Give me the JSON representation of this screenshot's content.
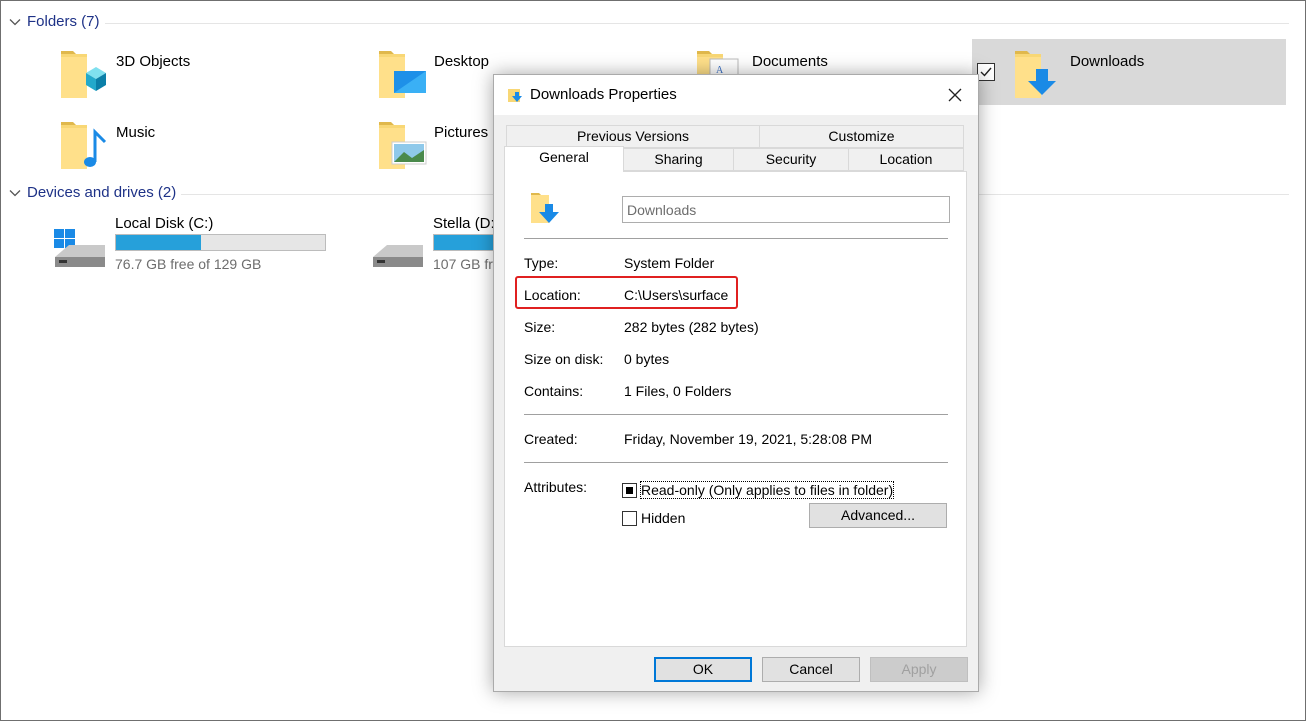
{
  "explorer": {
    "folders_group": {
      "title": "Folders (7)"
    },
    "folders": [
      {
        "label": "3D Objects",
        "icon": "3d-objects-folder-icon"
      },
      {
        "label": "Desktop",
        "icon": "desktop-folder-icon"
      },
      {
        "label": "Documents",
        "icon": "documents-folder-icon"
      },
      {
        "label": "Downloads",
        "icon": "downloads-folder-icon",
        "selected": true
      },
      {
        "label": "Music",
        "icon": "music-folder-icon"
      },
      {
        "label": "Pictures",
        "icon": "pictures-folder-icon"
      }
    ],
    "drives_group": {
      "title": "Devices and drives (2)"
    },
    "drives": [
      {
        "name": "Local Disk (C:)",
        "free": "76.7 GB free of 129 GB",
        "used_fraction": 0.405
      },
      {
        "name": "Stella (D:",
        "free": "107 GB fr",
        "used_fraction": 0.3
      }
    ]
  },
  "dialog": {
    "title": "Downloads Properties",
    "tabs_row1": [
      "Previous Versions",
      "Customize"
    ],
    "tabs_row2": [
      "General",
      "Sharing",
      "Security",
      "Location"
    ],
    "active_tab": "General",
    "name_value": "Downloads",
    "properties": {
      "type": {
        "label": "Type:",
        "value": "System Folder"
      },
      "location": {
        "label": "Location:",
        "value": "C:\\Users\\surface"
      },
      "size": {
        "label": "Size:",
        "value": "282 bytes (282 bytes)"
      },
      "size_on_disk": {
        "label": "Size on disk:",
        "value": "0 bytes"
      },
      "contains": {
        "label": "Contains:",
        "value": "1 Files, 0 Folders"
      },
      "created": {
        "label": "Created:",
        "value": "Friday, November 19, 2021, 5:28:08 PM"
      }
    },
    "attributes": {
      "label": "Attributes:",
      "readonly": "Read-only (Only applies to files in folder)",
      "hidden": "Hidden",
      "advanced": "Advanced..."
    },
    "buttons": {
      "ok": "OK",
      "cancel": "Cancel",
      "apply": "Apply"
    }
  },
  "colors": {
    "group_title": "#1e3287",
    "drive_fill": "#26a0da",
    "highlight": "#e02020",
    "selection": "#d9d9d9",
    "default_button_border": "#0078d7"
  }
}
